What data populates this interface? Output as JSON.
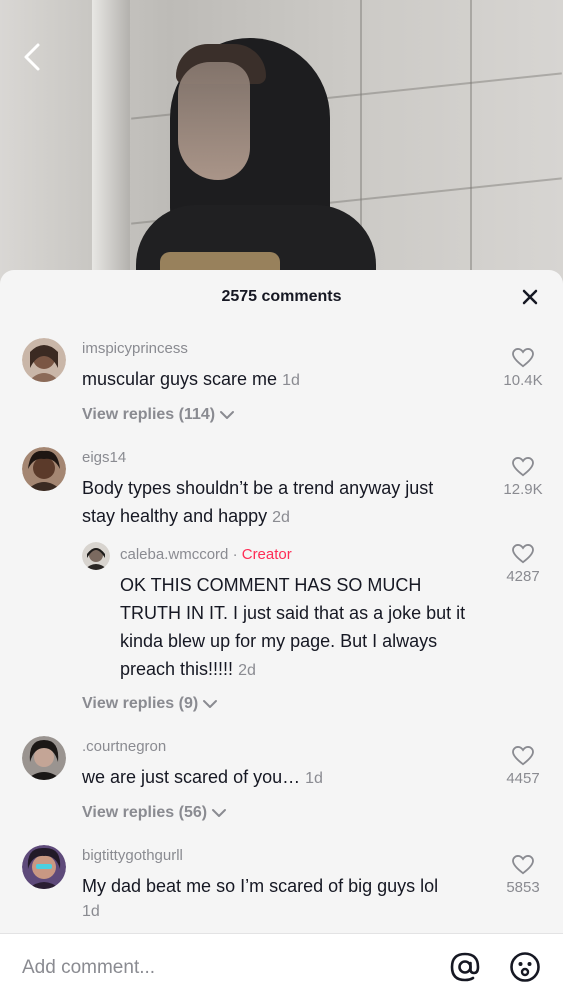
{
  "header": {
    "comment_count": "2575 comments"
  },
  "comments": [
    {
      "username": "imspicyprincess",
      "text": "muscular guys scare me",
      "time": "1d",
      "likes": "10.4K",
      "view_replies": "View replies (114)",
      "avatar_color": "#6b4f3f"
    },
    {
      "username": "eigs14",
      "text_line1": "Body types shouldn’t be a trend anyway just",
      "text_line2": "stay healthy and happy",
      "time": "2d",
      "likes": "12.9K",
      "avatar_color": "#5a3a2c",
      "reply": {
        "username": "caleba.wmccord",
        "separator": "·",
        "badge": "Creator",
        "text_line1": "OK THIS COMMENT HAS SO MUCH",
        "text_line2": "TRUTH IN IT. I just said that as a joke but it",
        "text_line3": "kinda blew up for my page. But I always",
        "text_line4": "preach this!!!!!",
        "time": "2d",
        "likes": "4287",
        "avatar_color": "#3a3530"
      },
      "view_replies": "View replies (9)"
    },
    {
      "username": ".courtnegron",
      "text": "we are just scared of you…",
      "time": "1d",
      "likes": "4457",
      "view_replies": "View replies (56)",
      "avatar_color": "#2b2422"
    },
    {
      "username": "bigtittygothgurll",
      "text": "My dad beat me so I’m scared of big guys lol",
      "time": "1d",
      "likes": "5853",
      "avatar_color": "#7a4f6a"
    }
  ],
  "input": {
    "placeholder": "Add comment..."
  },
  "icons": {
    "back": "chevron-left-icon",
    "close": "close-icon",
    "like": "heart-outline-icon",
    "expand": "chevron-down-icon",
    "mention": "at-sign-icon",
    "emoji": "emoji-icon"
  },
  "colors": {
    "creator": "#fe2c55",
    "sheet_bg": "#f5f5f5",
    "muted": "#8a8b91",
    "text": "#161823"
  }
}
